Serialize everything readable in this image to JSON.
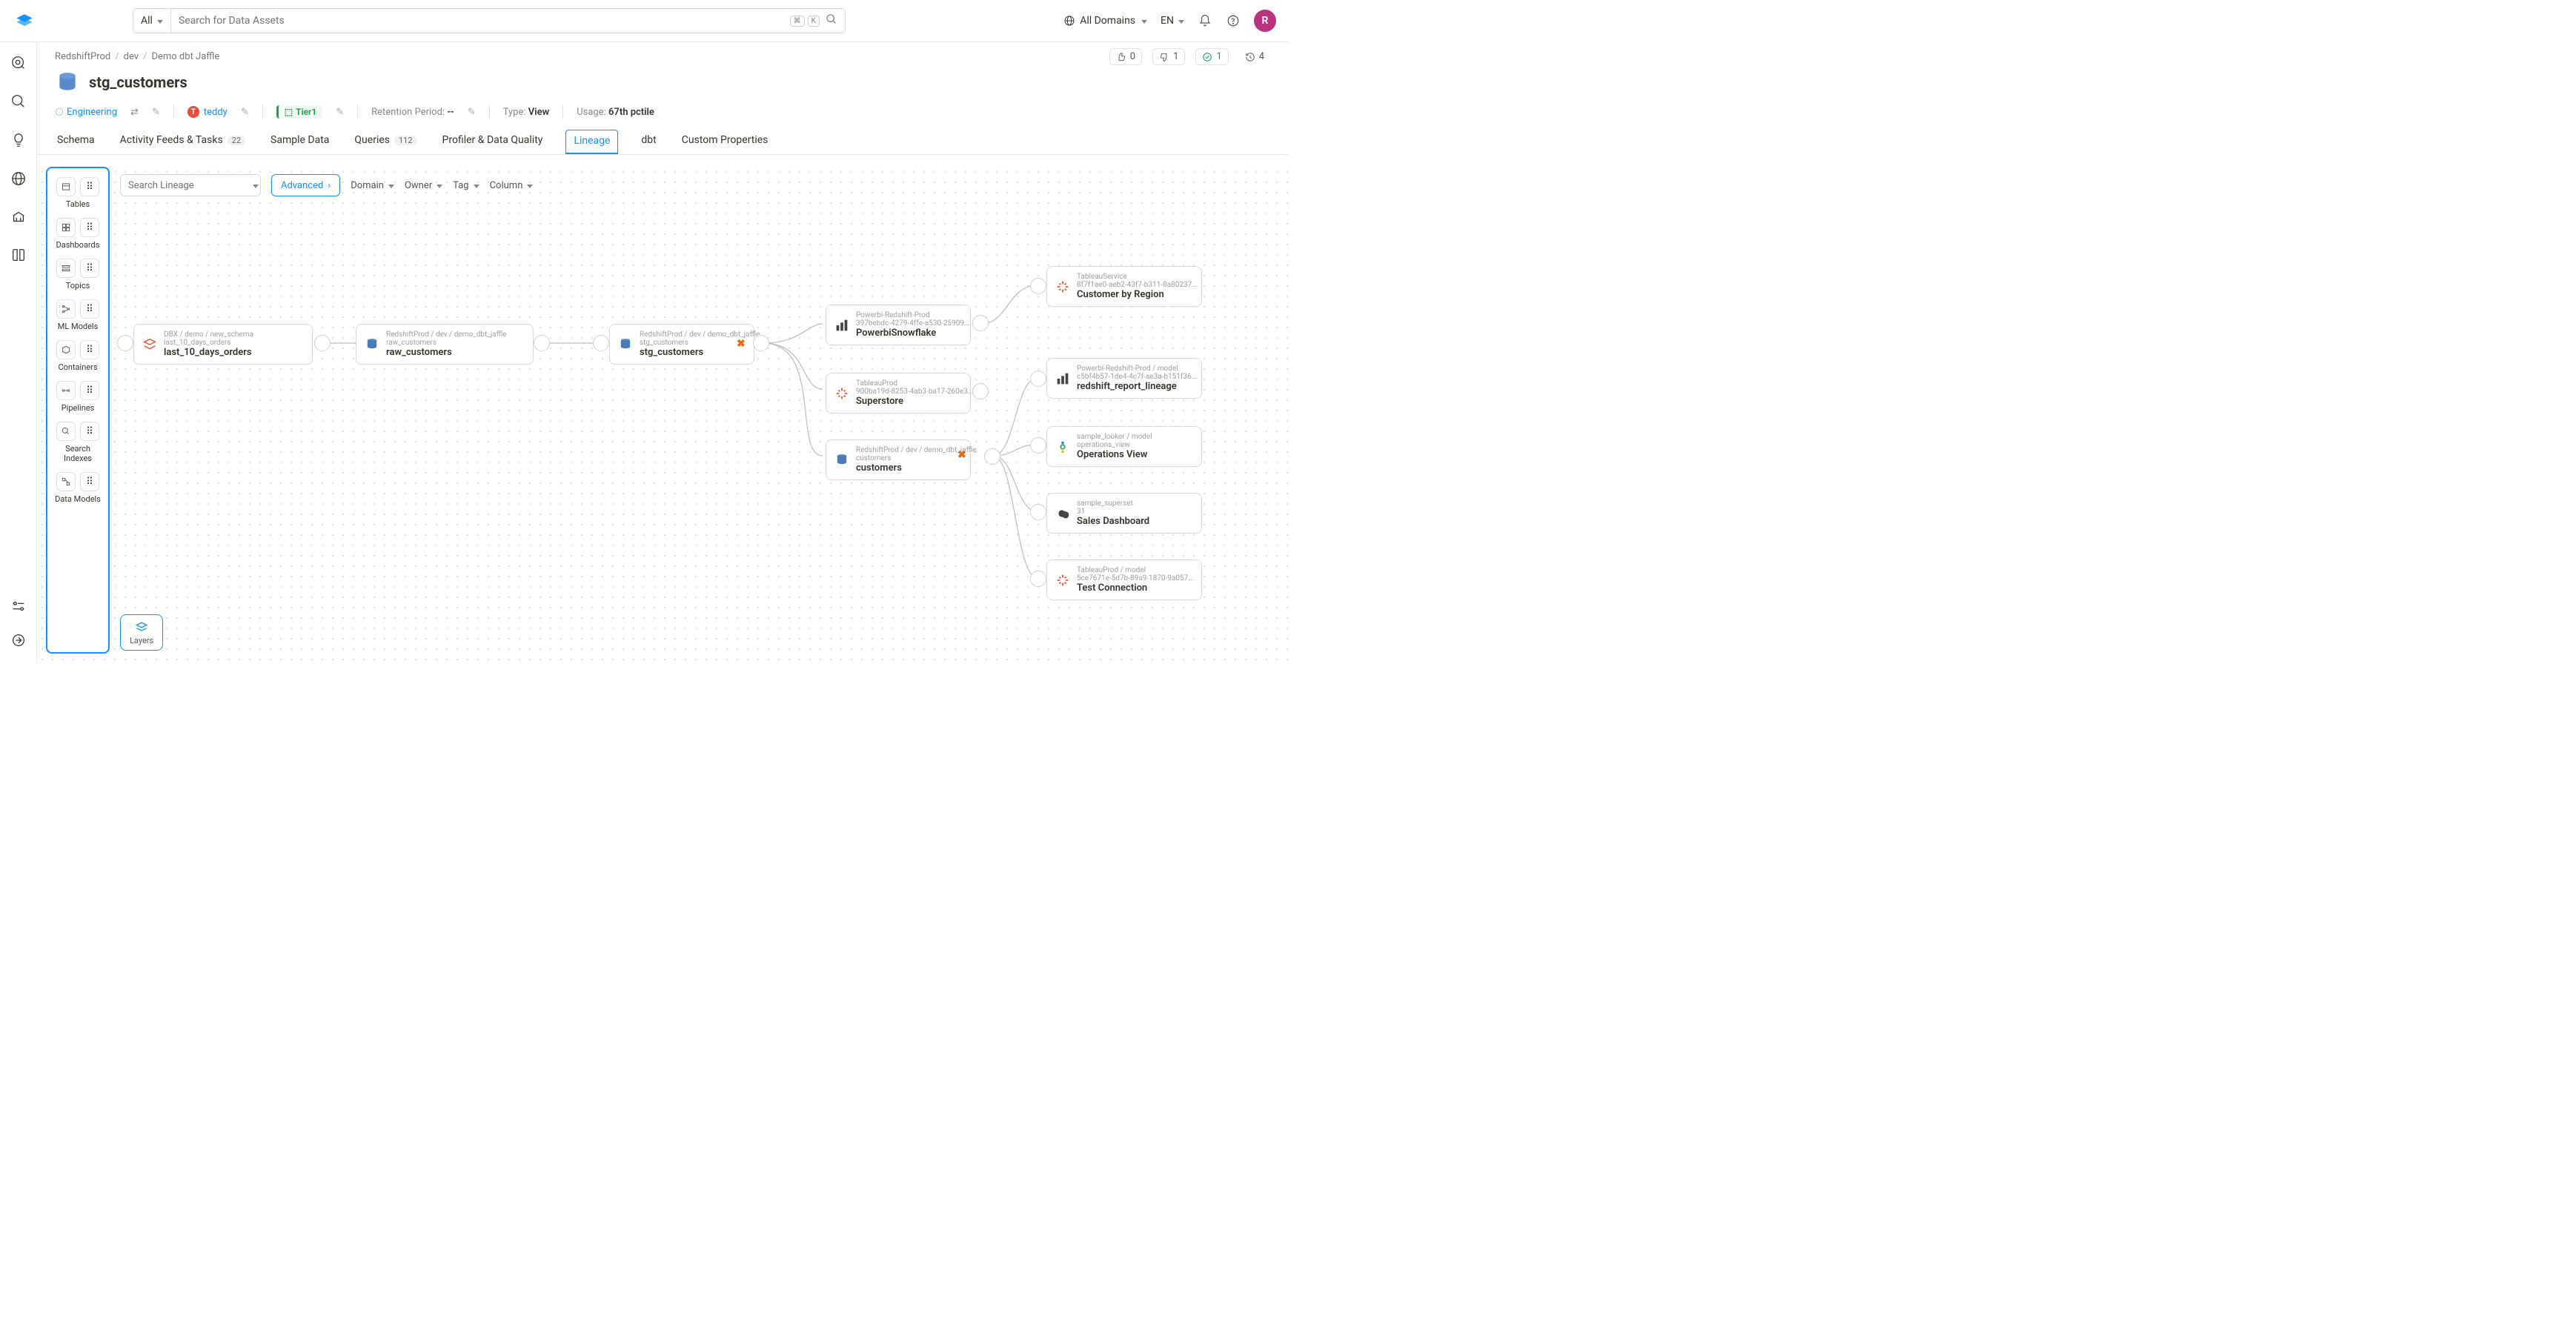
{
  "topbar": {
    "search_filter": "All",
    "search_placeholder": "Search for Data Assets",
    "kbd1": "⌘",
    "kbd2": "K",
    "domains": "All Domains",
    "lang": "EN",
    "avatar": "R"
  },
  "breadcrumb": [
    "RedshiftProd",
    "dev",
    "Demo dbt Jaffle"
  ],
  "metrics": {
    "like": "0",
    "dislike": "1",
    "green": "1",
    "history": "4"
  },
  "title": "stg_customers",
  "meta": {
    "domain": "Engineering",
    "owner": "teddy",
    "owner_initial": "T",
    "tier": "Tier1",
    "retention_label": "Retention Period:",
    "retention_val": "--",
    "type_label": "Type:",
    "type_val": "View",
    "usage_label": "Usage:",
    "usage_val": "67th pctile"
  },
  "tabs": [
    {
      "label": "Schema"
    },
    {
      "label": "Activity Feeds & Tasks",
      "badge": "22"
    },
    {
      "label": "Sample Data"
    },
    {
      "label": "Queries",
      "badge": "112"
    },
    {
      "label": "Profiler & Data Quality"
    },
    {
      "label": "Lineage",
      "active": true
    },
    {
      "label": "dbt"
    },
    {
      "label": "Custom Properties"
    }
  ],
  "toolbar": {
    "search_placeholder": "Search Lineage",
    "advanced": "Advanced",
    "filters": [
      "Domain",
      "Owner",
      "Tag",
      "Column"
    ]
  },
  "palette": [
    "Tables",
    "Dashboards",
    "Topics",
    "ML Models",
    "Containers",
    "Pipelines",
    "Search Indexes",
    "Data Models"
  ],
  "layers_label": "Layers",
  "nodes": {
    "n1": {
      "path": "DBX / demo / new_schema",
      "sub": "last_10_days_orders",
      "name": "last_10_days_orders"
    },
    "n2": {
      "path": "RedshiftProd / dev / demo_dbt_jaffle",
      "sub": "raw_customers",
      "name": "raw_customers"
    },
    "n3": {
      "path": "RedshiftProd / dev / demo_dbt_jaffle",
      "sub": "stg_customers",
      "name": "stg_customers"
    },
    "n4": {
      "path": "Powerbi-Redshift-Prod",
      "sub": "397bebdc-4279-4ffe-a530-25909...",
      "name": "PowerbiSnowflake"
    },
    "n5": {
      "path": "TableauProd",
      "sub": "900ba19d-8253-4ab3-ba17-260e3...",
      "name": "Superstore"
    },
    "n6": {
      "path": "RedshiftProd / dev / demo_dbt_jaffle",
      "sub": "customers",
      "name": "customers"
    },
    "n7": {
      "path": "TableauService",
      "sub": "8f7f1ae0-aeb2-43f7-b311-8a80237...",
      "name": "Customer by Region"
    },
    "n8": {
      "path": "Powerbi-Redshift-Prod / model",
      "sub": "c5bf4b57-1de4-4c7f-ae3a-b151f36...",
      "name": "redshift_report_lineage"
    },
    "n9": {
      "path": "sample_looker / model",
      "sub": "operations_view",
      "name": "Operations View"
    },
    "n10": {
      "path": "sample_superset",
      "sub": "31",
      "name": "Sales Dashboard"
    },
    "n11": {
      "path": "TableauProd / model",
      "sub": "5ce7671e-5d7b-89a9-1870-9a057...",
      "name": "Test Connection"
    }
  }
}
